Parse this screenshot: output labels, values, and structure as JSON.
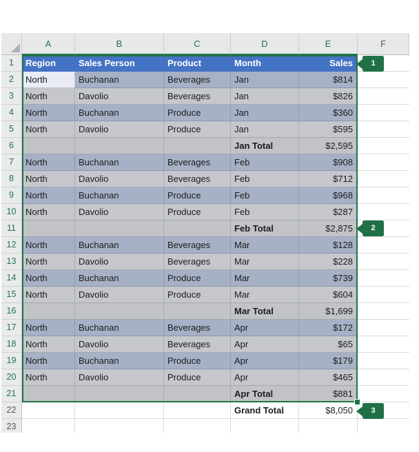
{
  "colors": {
    "header_blue": "#4472C4",
    "accent_green": "#217346",
    "badge_green": "#1F7145",
    "band_dark": "#A7B1C6",
    "band_light": "#C5C7CD",
    "band_total": "#C2C3C7",
    "active_cell": "#E9EBF5"
  },
  "sheet": {
    "columns": [
      {
        "letter": "A",
        "selected": true
      },
      {
        "letter": "B",
        "selected": true
      },
      {
        "letter": "C",
        "selected": true
      },
      {
        "letter": "D",
        "selected": true
      },
      {
        "letter": "E",
        "selected": true
      },
      {
        "letter": "F",
        "selected": false
      }
    ],
    "header_labels": [
      "Region",
      "Sales Person",
      "Product",
      "Month",
      "Sales"
    ],
    "rows": [
      {
        "num": "1",
        "type": "header",
        "selected": true,
        "cells": [
          "Region",
          "Sales Person",
          "Product",
          "Month",
          "Sales"
        ]
      },
      {
        "num": "2",
        "type": "dark",
        "selected": true,
        "active": true,
        "cells": [
          "North",
          "Buchanan",
          "Beverages",
          "Jan",
          "$814"
        ]
      },
      {
        "num": "3",
        "type": "light",
        "selected": true,
        "cells": [
          "North",
          "Davolio",
          "Beverages",
          "Jan",
          "$826"
        ]
      },
      {
        "num": "4",
        "type": "dark",
        "selected": true,
        "cells": [
          "North",
          "Buchanan",
          "Produce",
          "Jan",
          "$360"
        ]
      },
      {
        "num": "5",
        "type": "light",
        "selected": true,
        "cells": [
          "North",
          "Davolio",
          "Produce",
          "Jan",
          "$595"
        ]
      },
      {
        "num": "6",
        "type": "total",
        "selected": true,
        "cells": [
          "",
          "",
          "",
          "Jan Total",
          "$2,595"
        ]
      },
      {
        "num": "7",
        "type": "dark",
        "selected": true,
        "cells": [
          "North",
          "Buchanan",
          "Beverages",
          "Feb",
          "$908"
        ]
      },
      {
        "num": "8",
        "type": "light",
        "selected": true,
        "cells": [
          "North",
          "Davolio",
          "Beverages",
          "Feb",
          "$712"
        ]
      },
      {
        "num": "9",
        "type": "dark",
        "selected": true,
        "cells": [
          "North",
          "Buchanan",
          "Produce",
          "Feb",
          "$968"
        ]
      },
      {
        "num": "10",
        "type": "light",
        "selected": true,
        "cells": [
          "North",
          "Davolio",
          "Produce",
          "Feb",
          "$287"
        ]
      },
      {
        "num": "11",
        "type": "total",
        "selected": true,
        "cells": [
          "",
          "",
          "",
          "Feb Total",
          "$2,875"
        ]
      },
      {
        "num": "12",
        "type": "dark",
        "selected": true,
        "cells": [
          "North",
          "Buchanan",
          "Beverages",
          "Mar",
          "$128"
        ]
      },
      {
        "num": "13",
        "type": "light",
        "selected": true,
        "cells": [
          "North",
          "Davolio",
          "Beverages",
          "Mar",
          "$228"
        ]
      },
      {
        "num": "14",
        "type": "dark",
        "selected": true,
        "cells": [
          "North",
          "Buchanan",
          "Produce",
          "Mar",
          "$739"
        ]
      },
      {
        "num": "15",
        "type": "light",
        "selected": true,
        "cells": [
          "North",
          "Davolio",
          "Produce",
          "Mar",
          "$604"
        ]
      },
      {
        "num": "16",
        "type": "total",
        "selected": true,
        "cells": [
          "",
          "",
          "",
          "Mar Total",
          "$1,699"
        ]
      },
      {
        "num": "17",
        "type": "dark",
        "selected": true,
        "cells": [
          "North",
          "Buchanan",
          "Beverages",
          "Apr",
          "$172"
        ]
      },
      {
        "num": "18",
        "type": "light",
        "selected": true,
        "cells": [
          "North",
          "Davolio",
          "Beverages",
          "Apr",
          "$65"
        ]
      },
      {
        "num": "19",
        "type": "dark",
        "selected": true,
        "cells": [
          "North",
          "Buchanan",
          "Produce",
          "Apr",
          "$179"
        ]
      },
      {
        "num": "20",
        "type": "light",
        "selected": true,
        "cells": [
          "North",
          "Davolio",
          "Produce",
          "Apr",
          "$465"
        ]
      },
      {
        "num": "21",
        "type": "total",
        "selected": true,
        "cells": [
          "",
          "",
          "",
          "Apr Total",
          "$881"
        ]
      },
      {
        "num": "22",
        "type": "grand",
        "selected": false,
        "cells": [
          "",
          "",
          "",
          "Grand Total",
          "$8,050"
        ]
      },
      {
        "num": "23",
        "type": "plain",
        "selected": false,
        "cells": [
          "",
          "",
          "",
          "",
          ""
        ]
      }
    ]
  },
  "badges": [
    {
      "label": "1"
    },
    {
      "label": "2"
    },
    {
      "label": "3"
    }
  ]
}
